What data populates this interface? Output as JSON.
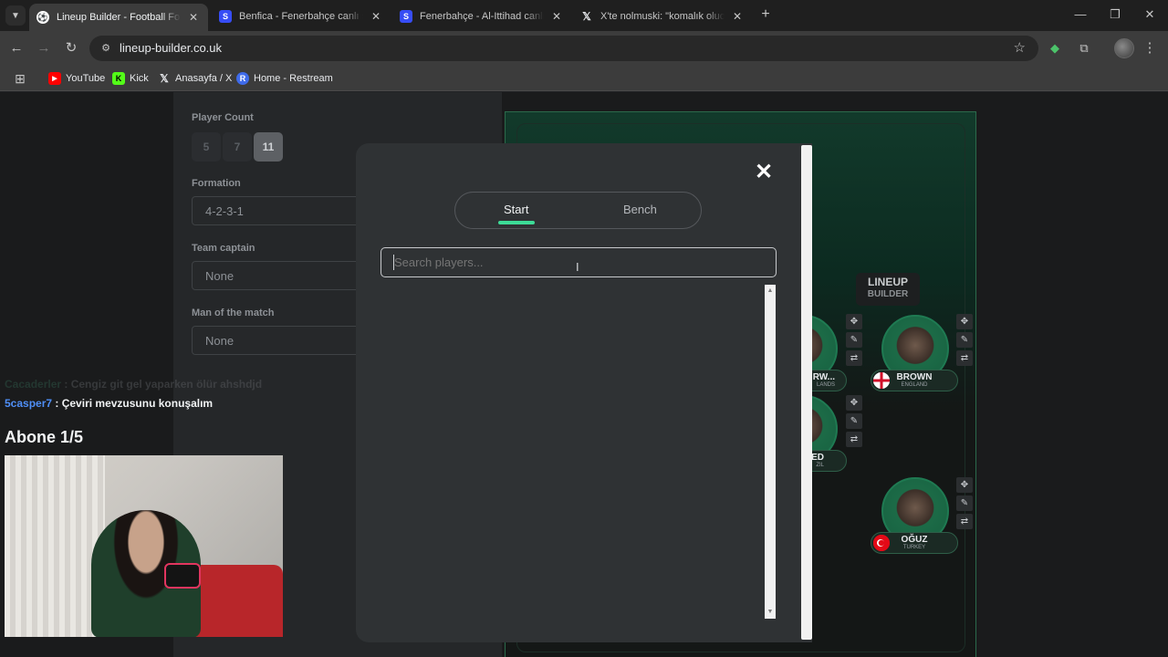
{
  "browser": {
    "tabs": [
      {
        "title": "Lineup Builder - Football Formation",
        "favicon": "football-icon",
        "active": true
      },
      {
        "title": "Benfica - Fenerbahçe canlı skor",
        "favicon": "sofascore-icon",
        "active": false
      },
      {
        "title": "Fenerbahçe - Al-Ittihad canlı skor",
        "favicon": "sofascore-icon",
        "active": false
      },
      {
        "title": "X'te nolmuski: \"komalık olucam",
        "favicon": "x-icon",
        "active": false
      }
    ],
    "url": "lineup-builder.co.uk",
    "bookmarks": [
      {
        "label": "YouTube",
        "icon": "youtube-icon",
        "color": "#ff0000"
      },
      {
        "label": "Kick",
        "icon": "kick-icon",
        "color": "#53fc18"
      },
      {
        "label": "Anasayfa / X",
        "icon": "x-icon",
        "color": "#e8eaed"
      },
      {
        "label": "Home - Restream",
        "icon": "restream-icon",
        "color": "#3f6bea"
      }
    ]
  },
  "form": {
    "player_count_label": "Player Count",
    "player_counts": [
      "5",
      "7",
      "11"
    ],
    "selected_count": "11",
    "formation_label": "Formation",
    "formation_value": "4-2-3-1",
    "captain_label": "Team captain",
    "captain_value": "None",
    "motm_label": "Man of the match",
    "motm_value": "None"
  },
  "pitch": {
    "logo_line1": "LINEUP",
    "logo_line2": "BUILDER",
    "players": [
      {
        "name": "BROWN",
        "country": "ENGLAND"
      },
      {
        "name": "OĞUZ",
        "country": "TURKEY"
      },
      {
        "name": "RW...",
        "country": "LANDS"
      },
      {
        "name": "ED",
        "country": "ZIL"
      }
    ]
  },
  "chat": {
    "messages": [
      {
        "user": "Cacaderler",
        "text": "Cengiz git gel yaparken ölür ahshdjd",
        "user_color": "#2e5a4a",
        "faded": true
      },
      {
        "user": "5casper7",
        "text": "Çeviri mevzusunu konuşalım",
        "user_color": "#4f8ff7",
        "faded": false
      }
    ],
    "sub_goal": "Abone 1/5"
  },
  "modal": {
    "tabs": {
      "start": "Start",
      "bench": "Bench"
    },
    "active_tab": "Start",
    "search_placeholder": "Search players...",
    "accent": "#3ddc97"
  }
}
